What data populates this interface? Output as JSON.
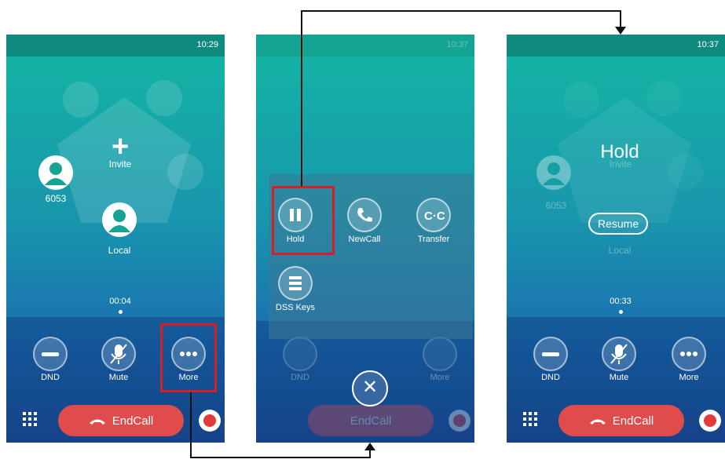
{
  "screen1": {
    "time": "10:29",
    "invite_label": "Invite",
    "contact_number": "6053",
    "local_label": "Local",
    "timer": "00:04",
    "controls": [
      {
        "icon": "minus-icon",
        "label": "DND"
      },
      {
        "icon": "mute-mic-icon",
        "label": "Mute"
      },
      {
        "icon": "more-dots-icon",
        "label": "More"
      }
    ],
    "endcall_label": "EndCall"
  },
  "screen2": {
    "time": "10:37",
    "menu_items": [
      {
        "icon": "pause-icon",
        "label": "Hold"
      },
      {
        "icon": "phone-icon",
        "label": "NewCall"
      },
      {
        "icon": "transfer-icon",
        "label": "Transfer"
      },
      {
        "icon": "dss-keys-icon",
        "label": "DSS Keys"
      }
    ],
    "bg_controls": [
      "DND",
      "More"
    ],
    "endcall_label": "EndCall"
  },
  "screen3": {
    "time": "10:37",
    "hold_title": "Hold",
    "invite_label": "Invite",
    "contact_number": "6053",
    "resume_label": "Resume",
    "local_label": "Local",
    "timer": "00:33",
    "controls": [
      {
        "icon": "minus-icon",
        "label": "DND"
      },
      {
        "icon": "mute-mic-icon",
        "label": "Mute"
      },
      {
        "icon": "more-dots-icon",
        "label": "More"
      }
    ],
    "endcall_label": "EndCall"
  },
  "colors": {
    "endcall": "#e04b4b",
    "highlight": "#d41f2a",
    "teal": "#13b7a3"
  }
}
